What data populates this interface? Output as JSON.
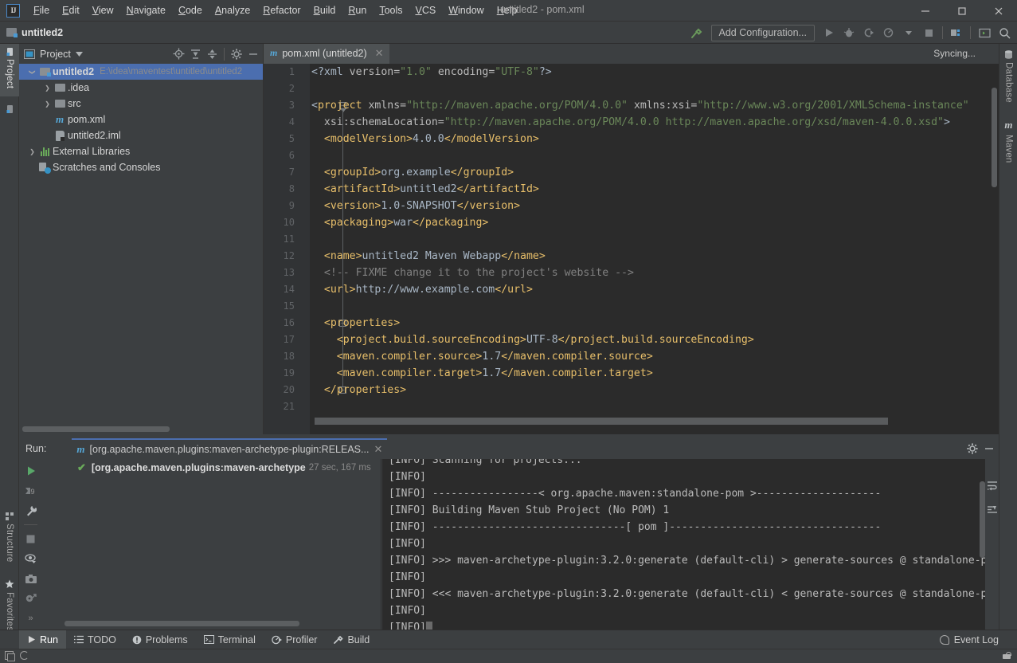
{
  "window": {
    "title": "untitled2 - pom.xml",
    "minimize_label": "─",
    "maximize_label": "☐",
    "close_label": "✕",
    "logo_text": "IJ"
  },
  "menubar": {
    "items": [
      {
        "label": "File"
      },
      {
        "label": "Edit"
      },
      {
        "label": "View"
      },
      {
        "label": "Navigate"
      },
      {
        "label": "Code"
      },
      {
        "label": "Analyze"
      },
      {
        "label": "Refactor"
      },
      {
        "label": "Build"
      },
      {
        "label": "Run"
      },
      {
        "label": "Tools"
      },
      {
        "label": "VCS"
      },
      {
        "label": "Window"
      },
      {
        "label": "Help"
      }
    ]
  },
  "navbar": {
    "breadcrumb": "untitled2",
    "add_configuration_label": "Add Configuration...",
    "icons": [
      "build-hammer-icon",
      "run-icon",
      "debug-icon",
      "run-with-coverage-icon",
      "profiler-icon",
      "dropdown-arrow-icon",
      "stop-icon",
      "project-structure-icon",
      "terminal-icon",
      "search-everywhere-icon"
    ]
  },
  "left_tool_strip": {
    "top_items": [
      {
        "label": "Project",
        "icon": "project-folder-icon",
        "active": true
      }
    ],
    "bottom_items": [
      {
        "label": "Structure",
        "icon": "structure-icon"
      },
      {
        "label": "Favorites",
        "icon": "star-icon"
      }
    ]
  },
  "right_tool_strip": {
    "items": [
      {
        "label": "Database",
        "icon": "database-icon"
      },
      {
        "label": "Maven",
        "icon": "maven-m-icon"
      }
    ]
  },
  "project_panel": {
    "title": "Project",
    "toolbar_icons": [
      "locate-target-icon",
      "expand-all-icon",
      "collapse-all-icon",
      "gear-icon",
      "hide-icon"
    ],
    "tree": [
      {
        "label": "untitled2",
        "path": "E:\\idea\\maventest\\untitled\\untitled2",
        "icon": "project-folder-icon",
        "indent": 0,
        "expanded": true,
        "selected": true,
        "bold": true
      },
      {
        "label": ".idea",
        "icon": "folder-icon",
        "indent": 1,
        "collapsed": true
      },
      {
        "label": "src",
        "icon": "folder-icon",
        "indent": 1,
        "collapsed": true
      },
      {
        "label": "pom.xml",
        "icon": "maven-m-icon",
        "indent": 1
      },
      {
        "label": "untitled2.iml",
        "icon": "iml-file-icon",
        "indent": 1
      },
      {
        "label": "External Libraries",
        "icon": "libraries-icon",
        "indent": 0,
        "collapsed": true
      },
      {
        "label": "Scratches and Consoles",
        "icon": "scratches-icon",
        "indent": 0
      }
    ]
  },
  "editor": {
    "tab": {
      "label": "pom.xml (untitled2)",
      "icon": "maven-m-icon",
      "close": "✕"
    },
    "status_hint": "Syncing...",
    "first_line": 1,
    "last_line": 21,
    "lines": [
      {
        "n": 1,
        "spans": [
          {
            "t": "pn",
            "v": "<?xml "
          },
          {
            "t": "at",
            "v": "version="
          },
          {
            "t": "av",
            "v": "\"1.0\""
          },
          {
            "t": "at",
            "v": " encoding="
          },
          {
            "t": "av",
            "v": "\"UTF-8\""
          },
          {
            "t": "pn",
            "v": "?>"
          }
        ]
      },
      {
        "n": 2,
        "spans": []
      },
      {
        "n": 3,
        "fold": "start",
        "spans": [
          {
            "t": "pn",
            "v": "<"
          },
          {
            "t": "tg",
            "v": "project"
          },
          {
            "t": "at",
            "v": " xmlns="
          },
          {
            "t": "av",
            "v": "\"http://maven.apache.org/POM/4.0.0\""
          },
          {
            "t": "at",
            "v": " xmlns:xsi="
          },
          {
            "t": "av",
            "v": "\"http://www.w3.org/2001/XMLSchema-instance\""
          }
        ]
      },
      {
        "n": 4,
        "spans": [
          {
            "t": "at",
            "v": "  xsi:schemaLocation="
          },
          {
            "t": "av",
            "v": "\"http://maven.apache.org/POM/4.0.0 http://maven.apache.org/xsd/maven-4.0.0.xsd\""
          },
          {
            "t": "pn",
            "v": ">"
          }
        ]
      },
      {
        "n": 5,
        "spans": [
          {
            "t": "tg",
            "v": "  <modelVersion>"
          },
          {
            "t": "txt",
            "v": "4.0.0"
          },
          {
            "t": "tg",
            "v": "</modelVersion>"
          }
        ]
      },
      {
        "n": 6,
        "spans": []
      },
      {
        "n": 7,
        "spans": [
          {
            "t": "tg",
            "v": "  <groupId>"
          },
          {
            "t": "txt",
            "v": "org.example"
          },
          {
            "t": "tg",
            "v": "</groupId>"
          }
        ]
      },
      {
        "n": 8,
        "spans": [
          {
            "t": "tg",
            "v": "  <artifactId>"
          },
          {
            "t": "txt",
            "v": "untitled2"
          },
          {
            "t": "tg",
            "v": "</artifactId>"
          }
        ]
      },
      {
        "n": 9,
        "spans": [
          {
            "t": "tg",
            "v": "  <version>"
          },
          {
            "t": "txt",
            "v": "1.0-SNAPSHOT"
          },
          {
            "t": "tg",
            "v": "</version>"
          }
        ]
      },
      {
        "n": 10,
        "spans": [
          {
            "t": "tg",
            "v": "  <packaging>"
          },
          {
            "t": "txt",
            "v": "war"
          },
          {
            "t": "tg",
            "v": "</packaging>"
          }
        ]
      },
      {
        "n": 11,
        "spans": []
      },
      {
        "n": 12,
        "spans": [
          {
            "t": "tg",
            "v": "  <name>"
          },
          {
            "t": "txt",
            "v": "untitled2 Maven Webapp"
          },
          {
            "t": "tg",
            "v": "</name>"
          }
        ]
      },
      {
        "n": 13,
        "spans": [
          {
            "t": "cm",
            "v": "  <!-- FIXME change it to the project's website -->"
          }
        ]
      },
      {
        "n": 14,
        "spans": [
          {
            "t": "tg",
            "v": "  <url>"
          },
          {
            "t": "txt",
            "v": "http://www.example.com"
          },
          {
            "t": "tg",
            "v": "</url>"
          }
        ]
      },
      {
        "n": 15,
        "spans": []
      },
      {
        "n": 16,
        "fold": "start",
        "spans": [
          {
            "t": "tg",
            "v": "  <properties>"
          }
        ]
      },
      {
        "n": 17,
        "spans": [
          {
            "t": "tg",
            "v": "    <project.build.sourceEncoding>"
          },
          {
            "t": "txt",
            "v": "UTF-8"
          },
          {
            "t": "tg",
            "v": "</project.build.sourceEncoding>"
          }
        ]
      },
      {
        "n": 18,
        "spans": [
          {
            "t": "tg",
            "v": "    <maven.compiler.source>"
          },
          {
            "t": "txt",
            "v": "1.7"
          },
          {
            "t": "tg",
            "v": "</maven.compiler.source>"
          }
        ]
      },
      {
        "n": 19,
        "spans": [
          {
            "t": "tg",
            "v": "    <maven.compiler.target>"
          },
          {
            "t": "txt",
            "v": "1.7"
          },
          {
            "t": "tg",
            "v": "</maven.compiler.target>"
          }
        ]
      },
      {
        "n": 20,
        "fold": "end",
        "spans": [
          {
            "t": "tg",
            "v": "  </properties>"
          }
        ]
      },
      {
        "n": 21,
        "spans": []
      }
    ]
  },
  "run_panel": {
    "label": "Run:",
    "tab_name": "[org.apache.maven.plugins:maven-archetype-plugin:RELEAS...",
    "tab_icon": "maven-m-icon",
    "tab_close": "✕",
    "header_icons": [
      "gear-icon",
      "hide-icon"
    ],
    "toolbar_icons": [
      "rerun-icon",
      "rerun-failed-tests-icon",
      "wrench-settings-icon",
      "stop-icon",
      "eye-filter-icon",
      "camera-snapshot-icon",
      "export-icon",
      "more-icon"
    ],
    "console_right_icons": [
      "soft-wrap-icon",
      "scroll-to-end-icon"
    ],
    "tree": [
      {
        "status": "passed",
        "check": "✔",
        "name": "[org.apache.maven.plugins:maven-archetype",
        "time": "27 sec, 167 ms"
      }
    ],
    "console_lines": [
      "[INFO] Scanning for projects...",
      "[INFO]",
      "[INFO] -----------------< org.apache.maven:standalone-pom >--------------------",
      "[INFO] Building Maven Stub Project (No POM) 1",
      "[INFO] -------------------------------[ pom ]----------------------------------",
      "[INFO]",
      "[INFO] >>> maven-archetype-plugin:3.2.0:generate (default-cli) > generate-sources @ standalone-p",
      "[INFO]",
      "[INFO] <<< maven-archetype-plugin:3.2.0:generate (default-cli) < generate-sources @ standalone-p",
      "[INFO]",
      "[INFO]"
    ]
  },
  "statusbar": {
    "tabs": [
      {
        "label": "Run",
        "icon": "run-icon",
        "active": true
      },
      {
        "label": "TODO",
        "icon": "todo-list-icon"
      },
      {
        "label": "Problems",
        "icon": "problems-icon"
      },
      {
        "label": "Terminal",
        "icon": "terminal-icon"
      },
      {
        "label": "Profiler",
        "icon": "profiler-icon"
      },
      {
        "label": "Build",
        "icon": "build-hammer-icon"
      }
    ],
    "event_log": "Event Log",
    "bottom_icons": [
      "toggle-panels-icon",
      "background-tasks-icon",
      "lock-icon"
    ]
  },
  "colors": {
    "accent_blue": "#4b6eaf",
    "panel_bg": "#3c3f41",
    "editor_bg": "#2b2b2b",
    "gutter_bg": "#313335",
    "tag": "#e8bf6a",
    "attr_value": "#6a8759",
    "text": "#a9b7c6",
    "comment": "#808080",
    "green": "#6aab5a",
    "maven_blue": "#56a8d8"
  }
}
